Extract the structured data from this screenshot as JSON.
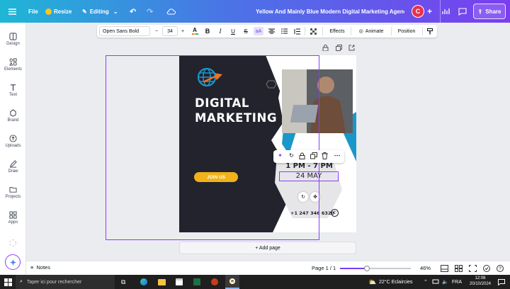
{
  "topbar": {
    "file": "File",
    "resize": "Resize",
    "editing": "Editing",
    "doc_title": "Yellow And Mainly Blue Modern Digital Marketing Agency In...",
    "avatar": "C",
    "share": "Share"
  },
  "sidebar": {
    "items": [
      {
        "label": "Design",
        "icon": "design-icon"
      },
      {
        "label": "Elements",
        "icon": "elements-icon"
      },
      {
        "label": "Text",
        "icon": "text-icon"
      },
      {
        "label": "Brand",
        "icon": "brand-icon"
      },
      {
        "label": "Uploads",
        "icon": "uploads-icon"
      },
      {
        "label": "Draw",
        "icon": "draw-icon"
      },
      {
        "label": "Projects",
        "icon": "projects-icon"
      },
      {
        "label": "Apps",
        "icon": "apps-icon"
      }
    ]
  },
  "toolbar": {
    "font": "Open Sans Bold",
    "minus": "−",
    "size": "34",
    "plus": "+",
    "bold": "B",
    "italic": "I",
    "underline": "U",
    "strike": "S",
    "case": "aA",
    "effects": "Effects",
    "animate": "Animate",
    "position": "Position"
  },
  "design": {
    "title_line1": "DIGITAL",
    "title_line2": "MARKETING",
    "join": "JOIN US",
    "time": "1 PM - 7 PM",
    "date": "24 MAY",
    "phone": "+1 247 346 6320",
    "colors": {
      "dark": "#23232e",
      "blue": "#1a97c9",
      "orange": "#e8742a",
      "yellow": "#f0b21a"
    }
  },
  "canvas": {
    "add_page": "+ Add page"
  },
  "bottombar": {
    "notes": "Notes",
    "page": "Page 1 / 1",
    "zoom": "46%",
    "zoom_level": 0.46
  },
  "taskbar": {
    "search": "Taper ici pour rechercher",
    "weather": "22°C  Eclaircies",
    "lang": "FRA",
    "time": "12:06",
    "date": "20/10/2024"
  }
}
